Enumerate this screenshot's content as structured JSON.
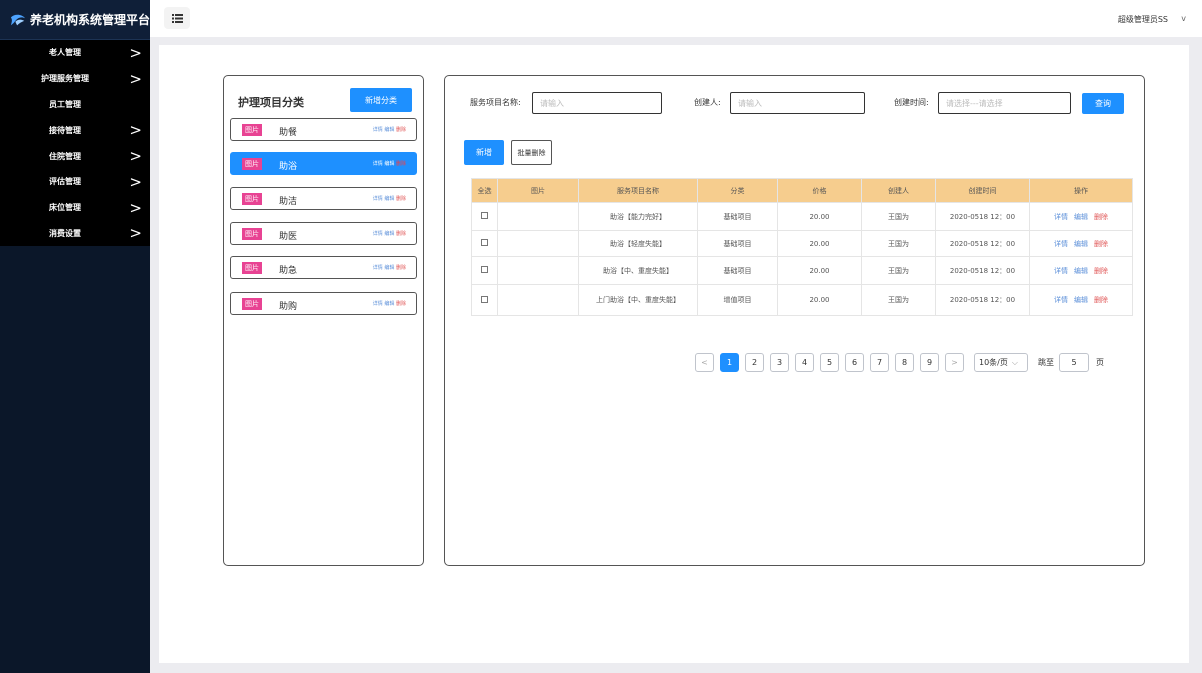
{
  "app": {
    "title": "养老机构系统管理平台"
  },
  "sidebar": {
    "items": [
      {
        "label": "老人管理",
        "has_arrow": true
      },
      {
        "label": "护理服务管理",
        "has_arrow": true
      },
      {
        "label": "员工管理",
        "has_arrow": false
      },
      {
        "label": "接待管理",
        "has_arrow": true
      },
      {
        "label": "住院管理",
        "has_arrow": true
      },
      {
        "label": "评估管理",
        "has_arrow": true
      },
      {
        "label": "床位管理",
        "has_arrow": true
      },
      {
        "label": "消费设置",
        "has_arrow": true
      }
    ],
    "arrow": ">"
  },
  "header": {
    "user": "超级管理员SS",
    "caret": "v"
  },
  "category_panel": {
    "title": "护理项目分类",
    "add_button": "新增分类",
    "pic_label": "图片",
    "op_detail": "详情",
    "op_edit": "编辑",
    "op_delete": "删除",
    "items": [
      {
        "name": "助餐",
        "active": false
      },
      {
        "name": "助浴",
        "active": true
      },
      {
        "name": "助洁",
        "active": false
      },
      {
        "name": "助医",
        "active": false
      },
      {
        "name": "助急",
        "active": false
      },
      {
        "name": "助购",
        "active": false
      }
    ]
  },
  "filters": {
    "name_label": "服务项目名称:",
    "name_placeholder": "请输入",
    "creator_label": "创建人:",
    "creator_placeholder": "请输入",
    "time_label": "创建时间:",
    "time_placeholder": "请选择---请选择",
    "search_button": "查询"
  },
  "actions": {
    "new_button": "新增",
    "batch_delete_button": "批量删除"
  },
  "table": {
    "columns": [
      "全选",
      "图片",
      "服务项目名称",
      "分类",
      "价格",
      "创建人",
      "创建时间",
      "操作"
    ],
    "op_detail": "详情",
    "op_edit": "编辑",
    "op_delete": "删除",
    "rows": [
      {
        "name": "助浴【能力完好】",
        "category": "基础项目",
        "price": "20.00",
        "creator": "王国为",
        "created": "2020-0518 12：00"
      },
      {
        "name": "助浴【轻度失能】",
        "category": "基础项目",
        "price": "20.00",
        "creator": "王国为",
        "created": "2020-0518 12：00"
      },
      {
        "name": "助浴【中、重度失能】",
        "category": "基础项目",
        "price": "20.00",
        "creator": "王国为",
        "created": "2020-0518 12：00"
      },
      {
        "name": "上门助浴【中、重度失能】",
        "category": "增值项目",
        "price": "20.00",
        "creator": "王国为",
        "created": "2020-0518 12：00"
      }
    ]
  },
  "pagination": {
    "prev": "<",
    "next": ">",
    "pages": [
      "1",
      "2",
      "3",
      "4",
      "5",
      "6",
      "7",
      "8",
      "9"
    ],
    "current_page": "1",
    "page_size": "10条/页",
    "jump_label": "跳至",
    "jump_value": "5",
    "page_unit": "页"
  }
}
